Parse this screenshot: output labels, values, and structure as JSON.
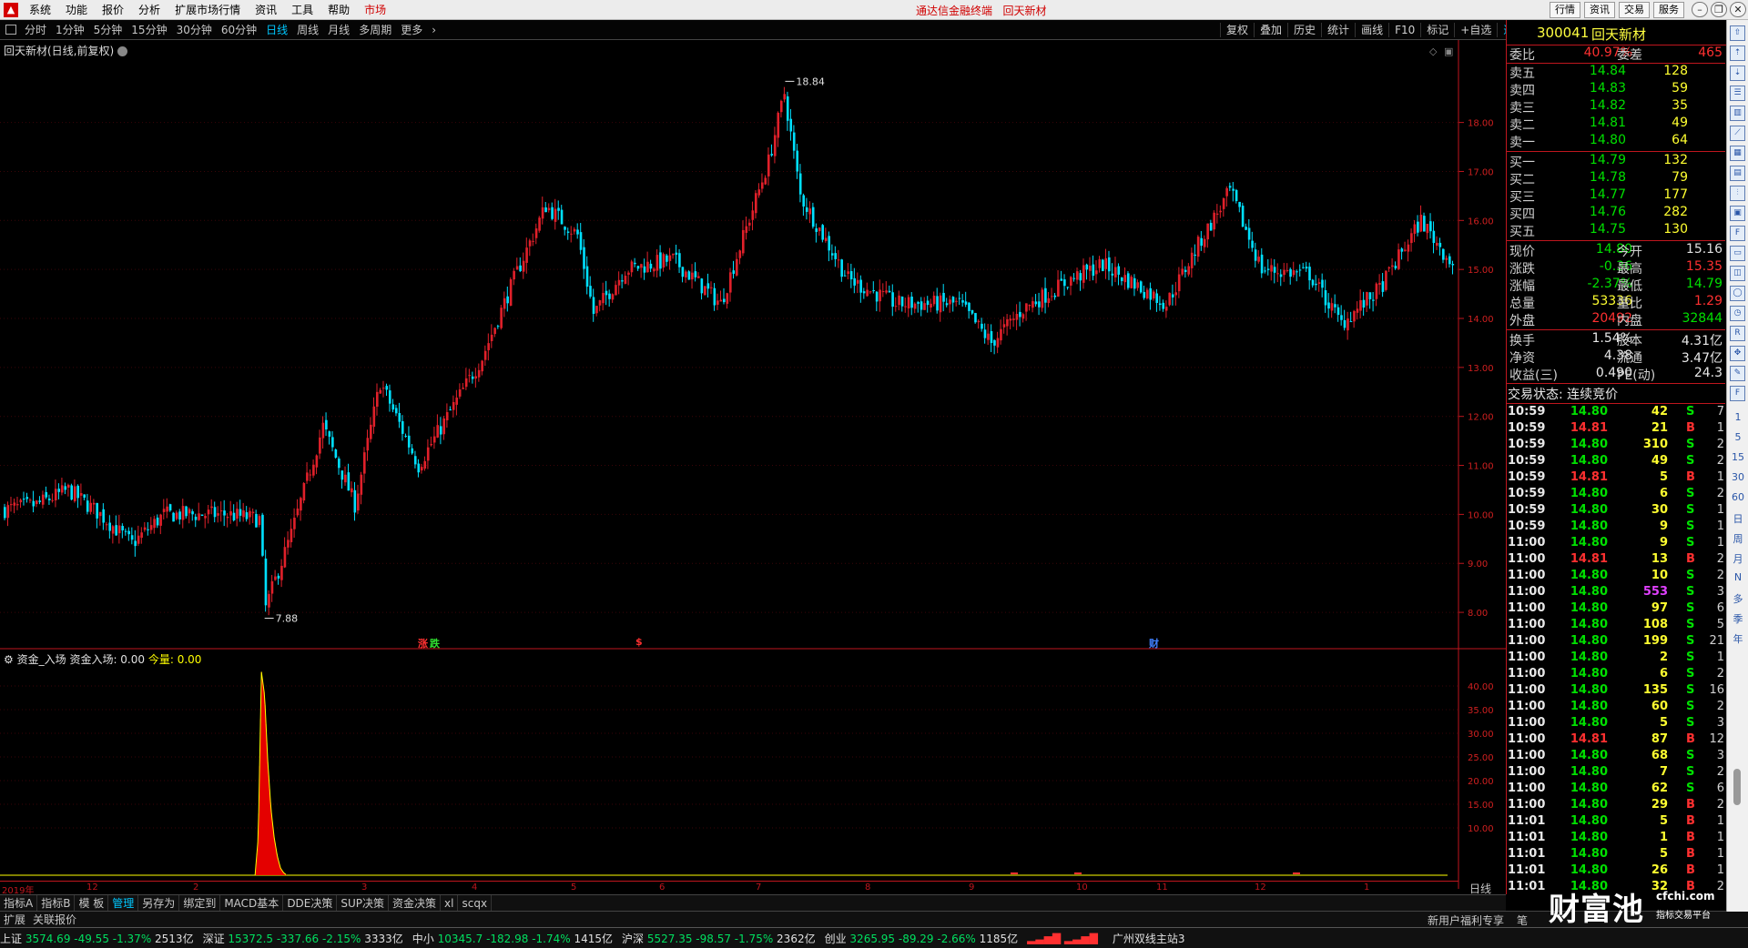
{
  "menubar": {
    "items": [
      "系统",
      "功能",
      "报价",
      "分析",
      "扩展市场行情",
      "资讯",
      "工具",
      "帮助"
    ],
    "market": "市场",
    "title": "通达信金融终端   回天新材",
    "right_buttons": [
      "行情",
      "资讯",
      "交易",
      "服务"
    ]
  },
  "periodbar": {
    "items": [
      "分时",
      "1分钟",
      "5分钟",
      "15分钟",
      "30分钟",
      "60分钟",
      "日线",
      "周线",
      "月线",
      "多周期",
      "更多"
    ],
    "active": "日线"
  },
  "toolbar": {
    "items": [
      "复权",
      "叠加",
      "历史",
      "统计",
      "画线",
      "F10",
      "标记",
      "+自选",
      "返回"
    ],
    "active": "返回"
  },
  "chart": {
    "title": "回天新材(日线,前复权)",
    "y_ticks": [
      "18.00",
      "17.00",
      "16.00",
      "15.00",
      "14.00",
      "13.00",
      "12.00",
      "11.00",
      "10.00",
      "9.00",
      "8.00"
    ],
    "y_vals": [
      18,
      17,
      16,
      15,
      14,
      13,
      12,
      11,
      10,
      9,
      8
    ],
    "high_label": "18.84",
    "low_label": "7.88",
    "events": [
      {
        "text": "涨",
        "color": "#ff3030"
      },
      {
        "text": "跌",
        "color": "#30e030"
      },
      {
        "text": "$",
        "color": "#ff3030"
      },
      {
        "text": "财",
        "color": "#4080ff"
      }
    ]
  },
  "volpane": {
    "title": "资金_入场",
    "field": "资金入场: 0.00",
    "field2": "今量: 0.00",
    "y_ticks": [
      "40.00",
      "35.00",
      "30.00",
      "25.00",
      "20.00",
      "15.00",
      "10.00"
    ],
    "y_vals": [
      40,
      35,
      30,
      25,
      20,
      15,
      10
    ]
  },
  "xaxis": {
    "labels": [
      "2019年",
      "12",
      "2",
      "3",
      "4",
      "5",
      "6",
      "7",
      "8",
      "9",
      "10",
      "11",
      "12",
      "1"
    ],
    "day_label": "日线"
  },
  "indicator_tabs": {
    "items": [
      "指标A",
      "指标B",
      "模 板",
      "管理",
      "另存为",
      "绑定到",
      "MACD基本",
      "DDE决策",
      "SUP决策",
      "资金决策",
      "xl",
      "scqx"
    ],
    "active": "管理"
  },
  "subbar": {
    "items": [
      "扩展",
      "关联报价"
    ],
    "new_user": "新用户福利专享",
    "bi": "笔"
  },
  "stock": {
    "code": "300041",
    "name": "回天新材"
  },
  "weibi": {
    "l1": "委比",
    "v1": "40.97%",
    "l2": "委差",
    "v2": "465"
  },
  "orderbook": {
    "asks": [
      {
        "label": "卖五",
        "price": "14.84",
        "vol": "128"
      },
      {
        "label": "卖四",
        "price": "14.83",
        "vol": "59"
      },
      {
        "label": "卖三",
        "price": "14.82",
        "vol": "35"
      },
      {
        "label": "卖二",
        "price": "14.81",
        "vol": "49"
      },
      {
        "label": "卖一",
        "price": "14.80",
        "vol": "64"
      }
    ],
    "bids": [
      {
        "label": "买一",
        "price": "14.79",
        "vol": "132"
      },
      {
        "label": "买二",
        "price": "14.78",
        "vol": "79"
      },
      {
        "label": "买三",
        "price": "14.77",
        "vol": "177"
      },
      {
        "label": "买四",
        "price": "14.76",
        "vol": "282"
      },
      {
        "label": "买五",
        "price": "14.75",
        "vol": "130"
      }
    ]
  },
  "quote": [
    {
      "l1": "现价",
      "v1": "14.80",
      "c1": "#00e000",
      "l2": "今开",
      "v2": "15.16",
      "c2": "#e0e0e0"
    },
    {
      "l1": "涨跌",
      "v1": "-0.36",
      "c1": "#00e000",
      "l2": "最高",
      "v2": "15.35",
      "c2": "#ff3030"
    },
    {
      "l1": "涨幅",
      "v1": "-2.37%",
      "c1": "#00e000",
      "l2": "最低",
      "v2": "14.79",
      "c2": "#00e000"
    },
    {
      "l1": "总量",
      "v1": "53336",
      "c1": "#ffff30",
      "l2": "量比",
      "v2": "1.29",
      "c2": "#ff3030"
    },
    {
      "l1": "外盘",
      "v1": "20492",
      "c1": "#ff3030",
      "l2": "内盘",
      "v2": "32844",
      "c2": "#00e000"
    }
  ],
  "quote2": [
    {
      "l1": "换手",
      "v1": "1.54%",
      "l2": "股本",
      "v2": "4.31亿"
    },
    {
      "l1": "净资",
      "v1": "4.38",
      "l2": "流通",
      "v2": "3.47亿"
    },
    {
      "l1": "收益(三)",
      "v1": "0.490",
      "l2": "PE(动)",
      "v2": "24.3"
    }
  ],
  "trade_status": "交易状态: 连续竞价",
  "ticks": [
    {
      "t": "10:59",
      "p": "14.80",
      "v": "42",
      "s": "S",
      "n": "7"
    },
    {
      "t": "10:59",
      "p": "14.81",
      "v": "21",
      "s": "B",
      "n": "1"
    },
    {
      "t": "10:59",
      "p": "14.80",
      "v": "310",
      "s": "S",
      "n": "2"
    },
    {
      "t": "10:59",
      "p": "14.80",
      "v": "49",
      "s": "S",
      "n": "2"
    },
    {
      "t": "10:59",
      "p": "14.81",
      "v": "5",
      "s": "B",
      "n": "1"
    },
    {
      "t": "10:59",
      "p": "14.80",
      "v": "6",
      "s": "S",
      "n": "2"
    },
    {
      "t": "10:59",
      "p": "14.80",
      "v": "30",
      "s": "S",
      "n": "1"
    },
    {
      "t": "10:59",
      "p": "14.80",
      "v": "9",
      "s": "S",
      "n": "1"
    },
    {
      "t": "11:00",
      "p": "14.80",
      "v": "9",
      "s": "S",
      "n": "1"
    },
    {
      "t": "11:00",
      "p": "14.81",
      "v": "13",
      "s": "B",
      "n": "2"
    },
    {
      "t": "11:00",
      "p": "14.80",
      "v": "10",
      "s": "S",
      "n": "2"
    },
    {
      "t": "11:00",
      "p": "14.80",
      "v": "553",
      "s": "S",
      "n": "3"
    },
    {
      "t": "11:00",
      "p": "14.80",
      "v": "97",
      "s": "S",
      "n": "6"
    },
    {
      "t": "11:00",
      "p": "14.80",
      "v": "108",
      "s": "S",
      "n": "5"
    },
    {
      "t": "11:00",
      "p": "14.80",
      "v": "199",
      "s": "S",
      "n": "21"
    },
    {
      "t": "11:00",
      "p": "14.80",
      "v": "2",
      "s": "S",
      "n": "1"
    },
    {
      "t": "11:00",
      "p": "14.80",
      "v": "6",
      "s": "S",
      "n": "2"
    },
    {
      "t": "11:00",
      "p": "14.80",
      "v": "135",
      "s": "S",
      "n": "16"
    },
    {
      "t": "11:00",
      "p": "14.80",
      "v": "60",
      "s": "S",
      "n": "2"
    },
    {
      "t": "11:00",
      "p": "14.80",
      "v": "5",
      "s": "S",
      "n": "3"
    },
    {
      "t": "11:00",
      "p": "14.81",
      "v": "87",
      "s": "B",
      "n": "12"
    },
    {
      "t": "11:00",
      "p": "14.80",
      "v": "68",
      "s": "S",
      "n": "3"
    },
    {
      "t": "11:00",
      "p": "14.80",
      "v": "7",
      "s": "S",
      "n": "2"
    },
    {
      "t": "11:00",
      "p": "14.80",
      "v": "62",
      "s": "S",
      "n": "6"
    },
    {
      "t": "11:00",
      "p": "14.80",
      "v": "29",
      "s": "B",
      "n": "2"
    },
    {
      "t": "11:01",
      "p": "14.80",
      "v": "5",
      "s": "B",
      "n": "1"
    },
    {
      "t": "11:01",
      "p": "14.80",
      "v": "1",
      "s": "B",
      "n": "1"
    },
    {
      "t": "11:01",
      "p": "14.80",
      "v": "5",
      "s": "B",
      "n": "1"
    },
    {
      "t": "11:01",
      "p": "14.80",
      "v": "26",
      "s": "B",
      "n": "1"
    },
    {
      "t": "11:01",
      "p": "14.80",
      "v": "32",
      "s": "B",
      "n": "2"
    }
  ],
  "statusbar": {
    "indices": [
      {
        "name": "上证",
        "val": "3574.69",
        "chg": "-49.55",
        "pct": "-1.37%",
        "amt": "2513亿"
      },
      {
        "name": "深证",
        "val": "15372.5",
        "chg": "-337.66",
        "pct": "-2.15%",
        "amt": "3333亿"
      },
      {
        "name": "中小",
        "val": "10345.7",
        "chg": "-182.98",
        "pct": "-1.74%",
        "amt": "1415亿"
      },
      {
        "name": "沪深",
        "val": "5527.35",
        "chg": "-98.57",
        "pct": "-1.75%",
        "amt": "2362亿"
      },
      {
        "name": "创业",
        "val": "3265.95",
        "chg": "-89.29",
        "pct": "-2.66%",
        "amt": "1185亿"
      }
    ],
    "server": "广州双线主站3"
  },
  "sidetools": {
    "texts": [
      "1",
      "5",
      "15",
      "30",
      "60",
      "日",
      "周",
      "月",
      "N",
      "多",
      "季",
      "年"
    ]
  },
  "watermark": {
    "big": "财富池",
    "domain": "cfchi.com",
    "sub": "指标交易平台"
  },
  "colors": {
    "up": "#e0202a",
    "down": "#00e0ff",
    "grid": "#7a0a10",
    "price_axis": "#d02020",
    "vol_bar": "#ff0000",
    "vol_line": "#ffff00"
  },
  "chart_data": {
    "type": "candlestick",
    "title": "回天新材(日线,前复权)",
    "ylim": [
      7.5,
      19.2
    ],
    "y_ticks": [
      8,
      9,
      10,
      11,
      12,
      13,
      14,
      15,
      16,
      17,
      18
    ],
    "x_month_labels": [
      "2019年",
      "12",
      "2",
      "3",
      "4",
      "5",
      "6",
      "7",
      "8",
      "9",
      "10",
      "11",
      "12",
      "1"
    ],
    "high": 18.84,
    "low": 7.88,
    "close_path": [
      [
        0,
        10.1
      ],
      [
        10,
        10.2
      ],
      [
        20,
        10.5
      ],
      [
        30,
        10.0
      ],
      [
        40,
        9.4
      ],
      [
        50,
        10.0
      ],
      [
        60,
        10.0
      ],
      [
        70,
        10.0
      ],
      [
        80,
        9.9
      ],
      [
        82,
        8.1
      ],
      [
        90,
        9.6
      ],
      [
        100,
        11.8
      ],
      [
        110,
        10.2
      ],
      [
        118,
        12.7
      ],
      [
        130,
        11.0
      ],
      [
        150,
        13.2
      ],
      [
        160,
        14.8
      ],
      [
        170,
        16.3
      ],
      [
        180,
        15.7
      ],
      [
        185,
        14.1
      ],
      [
        195,
        15.0
      ],
      [
        210,
        15.2
      ],
      [
        225,
        14.3
      ],
      [
        240,
        17.2
      ],
      [
        245,
        18.6
      ],
      [
        250,
        16.5
      ],
      [
        265,
        14.8
      ],
      [
        280,
        14.3
      ],
      [
        300,
        14.3
      ],
      [
        310,
        13.5
      ],
      [
        320,
        14.2
      ],
      [
        335,
        14.8
      ],
      [
        345,
        15.1
      ],
      [
        365,
        14.3
      ],
      [
        375,
        15.5
      ],
      [
        385,
        16.6
      ],
      [
        395,
        15.0
      ],
      [
        410,
        14.9
      ],
      [
        420,
        13.9
      ],
      [
        432,
        14.6
      ],
      [
        445,
        16.0
      ],
      [
        455,
        15.1
      ]
    ],
    "volume_series": {
      "name": "资金_入场",
      "ylim": [
        0,
        45
      ],
      "y_ticks": [
        10,
        15,
        20,
        25,
        30,
        35,
        40
      ],
      "spike": [
        [
          79,
          0
        ],
        [
          80,
          8
        ],
        [
          81,
          43
        ],
        [
          82,
          38
        ],
        [
          83,
          24
        ],
        [
          84,
          14
        ],
        [
          85,
          8
        ],
        [
          86,
          4
        ],
        [
          87,
          1.5
        ],
        [
          88,
          0.5
        ],
        [
          89,
          0
        ]
      ]
    }
  }
}
